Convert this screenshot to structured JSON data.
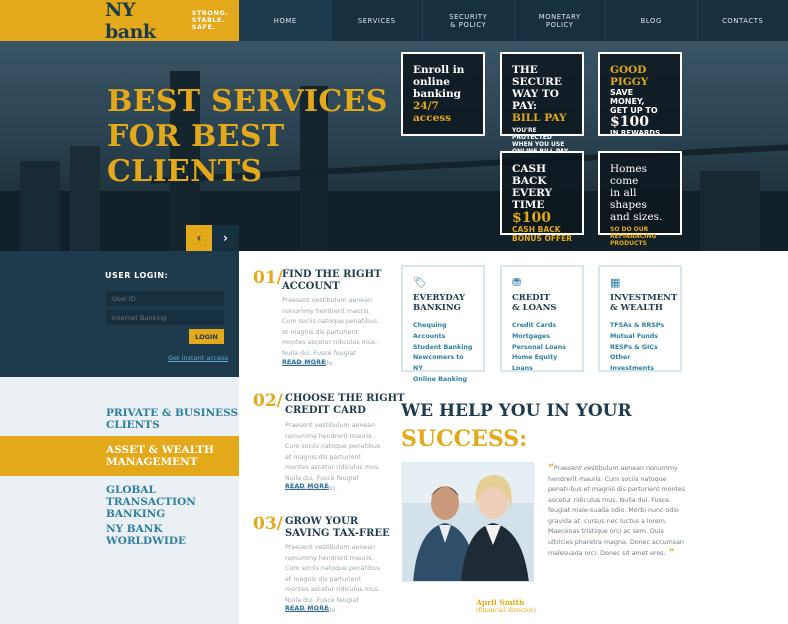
{
  "brand": {
    "name": "NY bank",
    "tagline": "STRONG. STABLE. SAFE."
  },
  "nav": [
    {
      "label": "HOME"
    },
    {
      "label": "SERVICES"
    },
    {
      "label": "SECURITY\n& POLICY"
    },
    {
      "label": "MONETARY\nPOLICY"
    },
    {
      "label": "BLOG"
    },
    {
      "label": "CONTACTS"
    }
  ],
  "hero": {
    "title": "BEST SERVICES\nFOR BEST\nCLIENTS",
    "prev": "‹",
    "next": "›"
  },
  "promos": {
    "enroll": {
      "l1": "Enroll in",
      "l2": "online",
      "l3": "banking",
      "l4": "24/7",
      "l5": "access"
    },
    "secure": {
      "l1": "THE SECURE",
      "l2": "WAY TO PAY:",
      "l3": "BILL PAY",
      "l4": "YOU'RE PROTECTED",
      "l5": "WHEN YOU USE",
      "l6": "ONLINE BILL PAY"
    },
    "piggy": {
      "l1": "GOOD PIGGY",
      "l2": "SAVE MONEY,",
      "l3": "GET UP TO",
      "l4": "$100",
      "l5": "IN REWARDS"
    },
    "cashback": {
      "l1": "CASH BACK",
      "l2": "EVERY TIME",
      "l3": "$100",
      "l4": "CASH BACK",
      "l5": "BONUS OFFER"
    },
    "homes": {
      "l1": "Homes come",
      "l2": "in all shapes",
      "l3": "and sizes.",
      "l4": "SO DO OUR",
      "l5": "REFINANCING",
      "l6": "PRODUCTS"
    }
  },
  "login": {
    "title": "USER LOGIN:",
    "user_placeholder": "User ID",
    "pass_placeholder": "Internet Banking",
    "button": "LOGIN",
    "instant": "Get instant access"
  },
  "sidebar": [
    {
      "label": "PRIVATE & BUSINESS\nCLIENTS"
    },
    {
      "label": "ASSET & WEALTH\nMANAGEMENT"
    },
    {
      "label": "GLOBAL TRANSACTION\nBANKING"
    },
    {
      "label": "NY BANK\nWORLDWIDE"
    }
  ],
  "features": [
    {
      "num": "01/",
      "title": "FIND THE RIGHT\nACCOUNT",
      "text": "Praesent vestibulum aenean nonummy hendrerit mauris. Cum sociis natoque penatibus et magnis dis parturient montes ascetur ridiculus mus. Nulla dui. Fusce feugiat malesuada odio.",
      "more": "READ MORE"
    },
    {
      "num": "02/",
      "title": "CHOOSE THE RIGHT\nCREDIT CARD",
      "text": "Praesent vestibulum aenean nonummy hendrerit mauris. Cum sociis natoque penatibus et magnis dis parturient montes ascetur ridiculus mus. Nulla dui. Fusce feugiat malesuada odio.",
      "more": "READ MORE"
    },
    {
      "num": "03/",
      "title": "GROW YOUR\nSAVING TAX-FREE",
      "text": "Praesent vestibulum aenean nonummy hendrerit mauris. Cum sociis natoque penatibus et magnis dis parturient montes ascetur ridiculus mus. Nulla dui. Fusce feugiat malesuada odio.",
      "more": "READ MORE"
    }
  ],
  "boxes": [
    {
      "icon": "tag-icon",
      "title": "EVERYDAY\nBANKING",
      "items": [
        "Chequing Accounts",
        "Student Banking",
        "Newcomers to NY",
        "Online Banking"
      ]
    },
    {
      "icon": "coins-icon",
      "title": "CREDIT\n& LOANS",
      "items": [
        "Credit Cards",
        "Mortgages",
        "Personal Loans",
        "Home Equity Loans"
      ]
    },
    {
      "icon": "calculator-icon",
      "title": "INVESTMENT\n& WEALTH",
      "items": [
        "TFSAs & RRSPs",
        "Mutual Funds",
        "RESPs & GICs",
        "Other Investments"
      ]
    }
  ],
  "help": {
    "heading": "WE HELP YOU IN YOUR",
    "highlight": "SUCCESS:",
    "quote": "Praesent vestibulum aenean nonummy hendrerit mauris. Cum sociis natoque penati-bus et magnis dis parturient montes ascetur ridiculus mus. Nulla dui. Fusce feugiat male-suada odio. Morbi nunc odio gravida at. cursus nec luctus a lorem. Maecenas tristique orci ac sem. Duis ultricies pharetra magna. Donec accumsan malesuada orci. Donec sit amet eros.",
    "author": "April Smith",
    "role": "(financial director)"
  }
}
